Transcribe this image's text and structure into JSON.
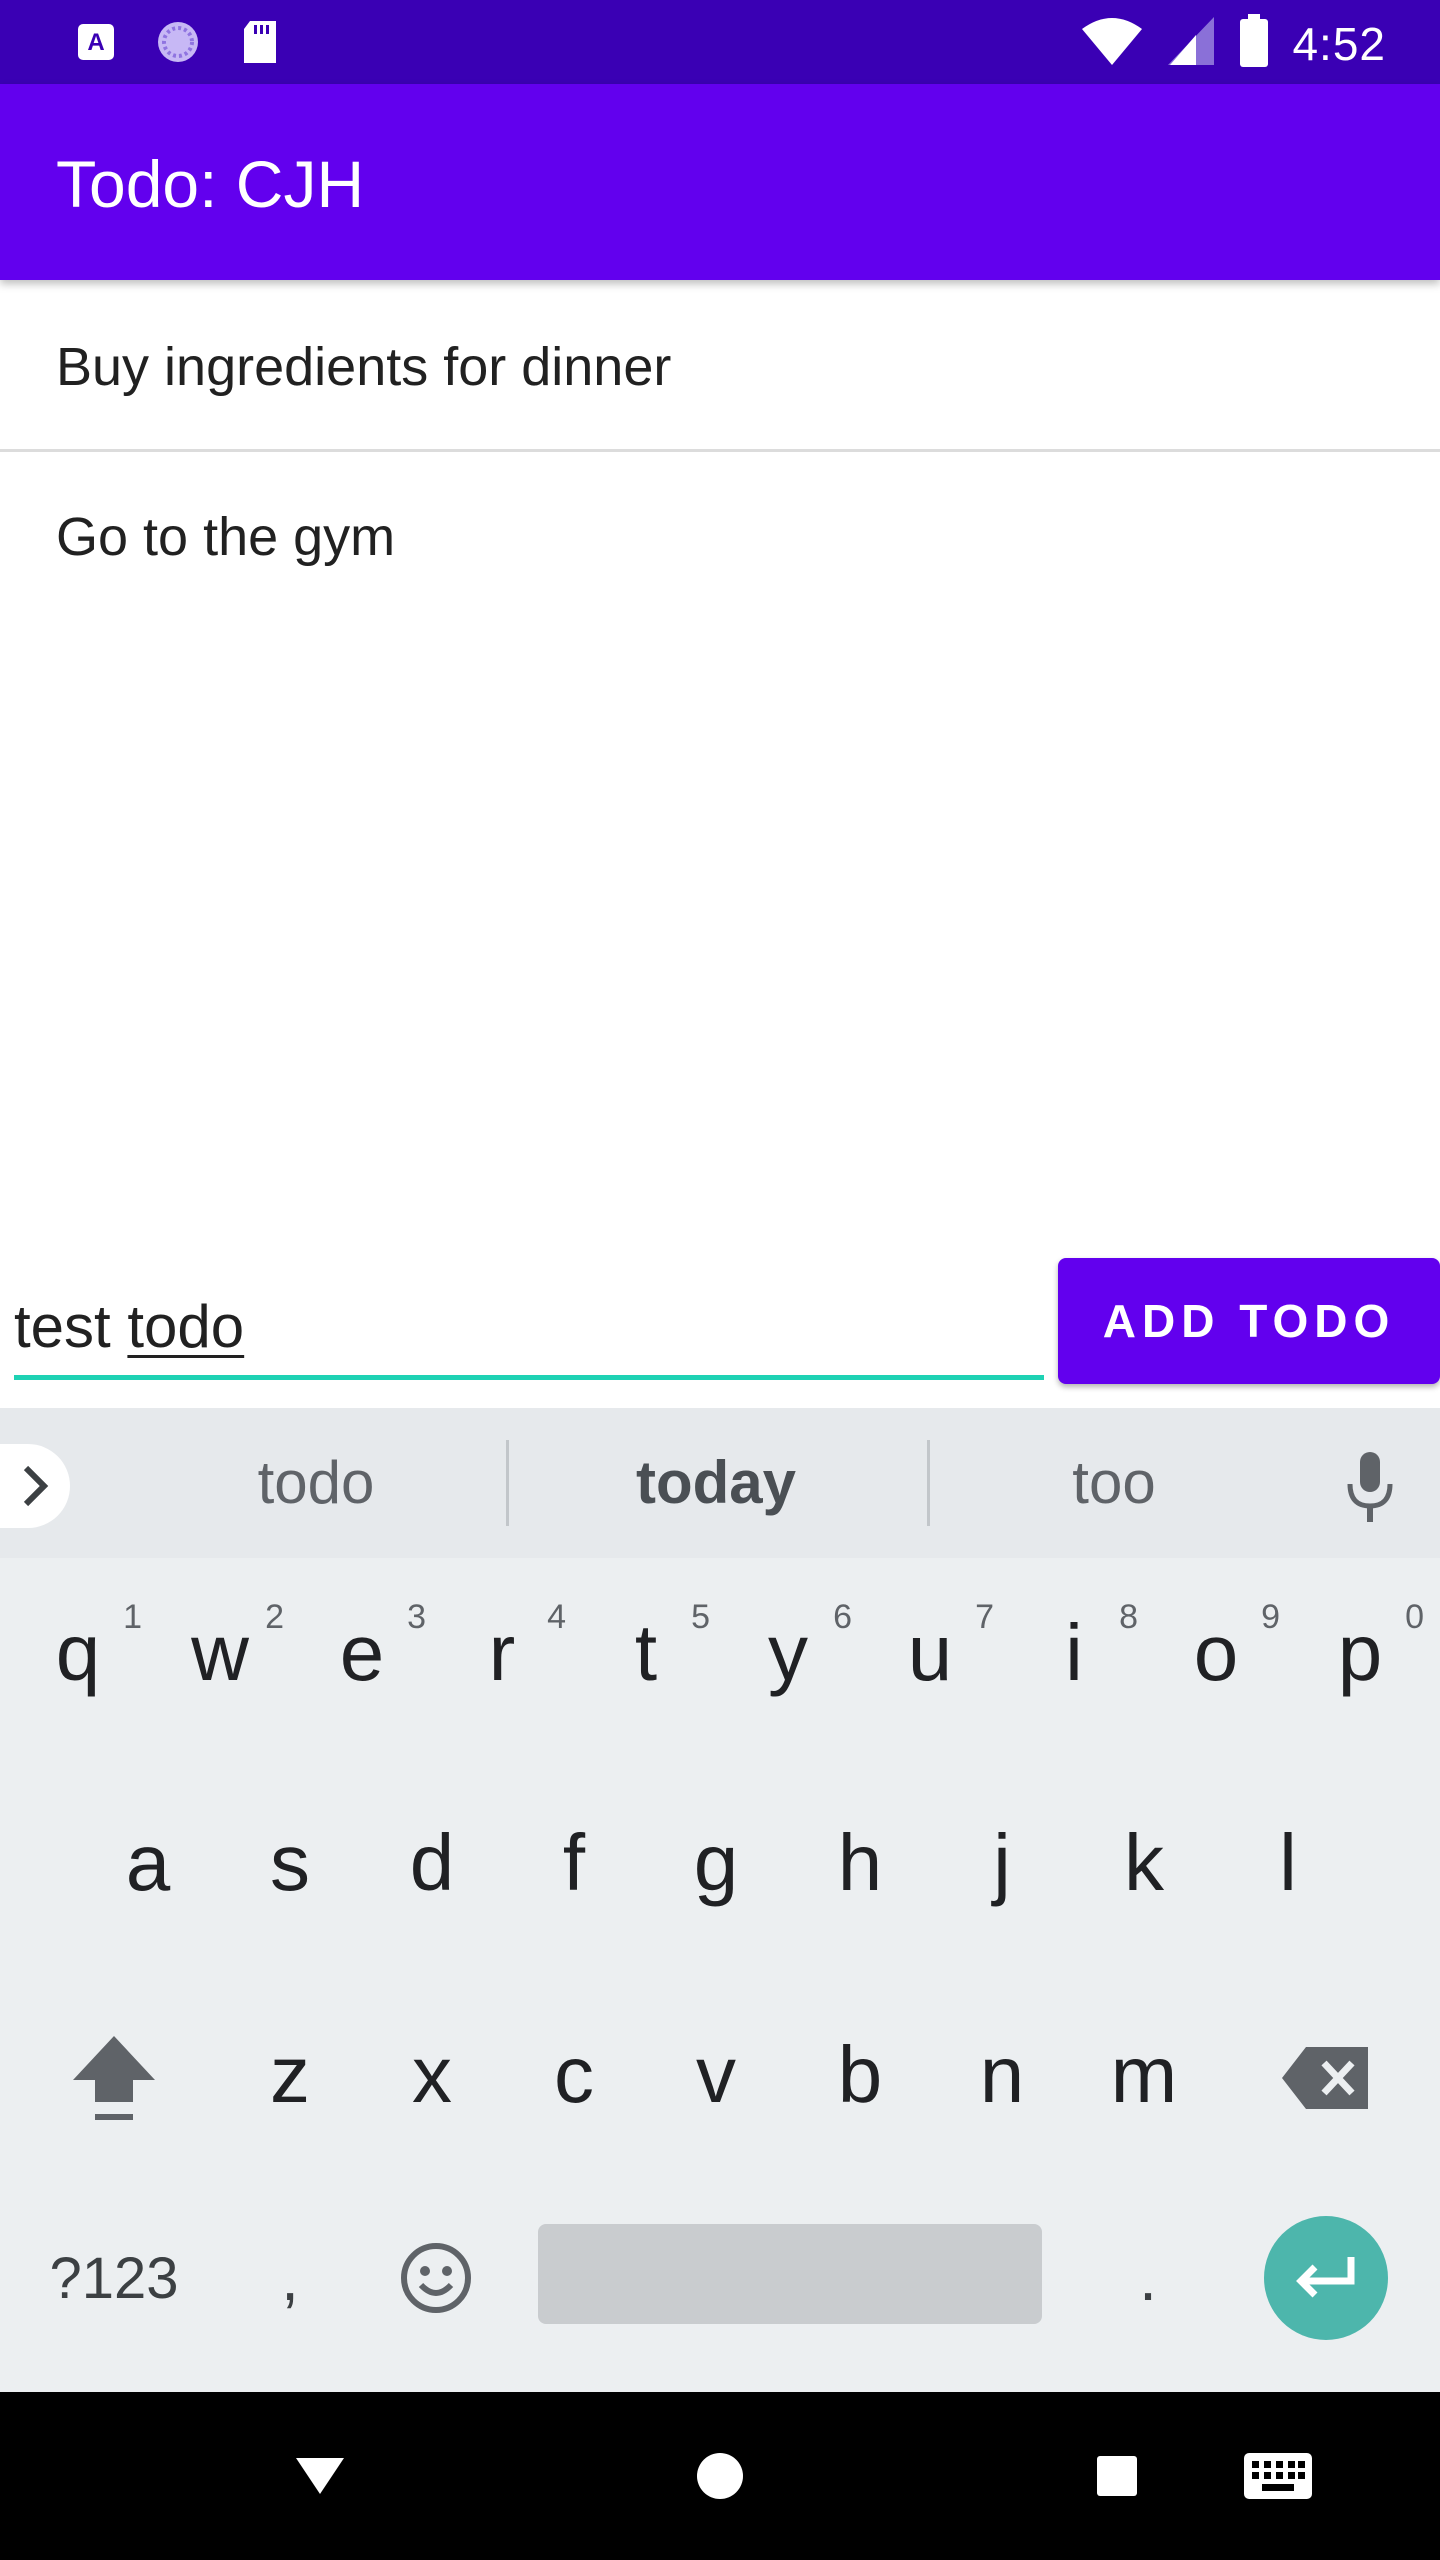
{
  "status_bar": {
    "time": "4:52",
    "left_icons": [
      "app-a-icon",
      "loading-circle-icon",
      "sd-card-icon"
    ],
    "right_icons": [
      "wifi-icon",
      "signal-icon",
      "battery-icon"
    ]
  },
  "app_bar": {
    "title": "Todo: CJH"
  },
  "todos": [
    {
      "text": "Buy ingredients for dinner"
    },
    {
      "text": "Go to the gym"
    }
  ],
  "input": {
    "value_plain": "test ",
    "value_composing": "todo",
    "underline_color": "#1ed2b4"
  },
  "add_button": {
    "label": "ADD TODO",
    "color": "#6200ee"
  },
  "keyboard": {
    "suggestions": [
      "todo",
      "today",
      "too"
    ],
    "row1": [
      {
        "ch": "q",
        "hint": "1"
      },
      {
        "ch": "w",
        "hint": "2"
      },
      {
        "ch": "e",
        "hint": "3"
      },
      {
        "ch": "r",
        "hint": "4"
      },
      {
        "ch": "t",
        "hint": "5"
      },
      {
        "ch": "y",
        "hint": "6"
      },
      {
        "ch": "u",
        "hint": "7"
      },
      {
        "ch": "i",
        "hint": "8"
      },
      {
        "ch": "o",
        "hint": "9"
      },
      {
        "ch": "p",
        "hint": "0"
      }
    ],
    "row2": [
      "a",
      "s",
      "d",
      "f",
      "g",
      "h",
      "j",
      "k",
      "l"
    ],
    "row3": [
      "z",
      "x",
      "c",
      "v",
      "b",
      "n",
      "m"
    ],
    "symbols_label": "?123",
    "comma": ",",
    "period": ".",
    "enter_color": "#4db6ac"
  },
  "colors": {
    "status_bar": "#3a00b4",
    "app_bar": "#6200ee",
    "keyboard_bg": "#eceff1"
  }
}
